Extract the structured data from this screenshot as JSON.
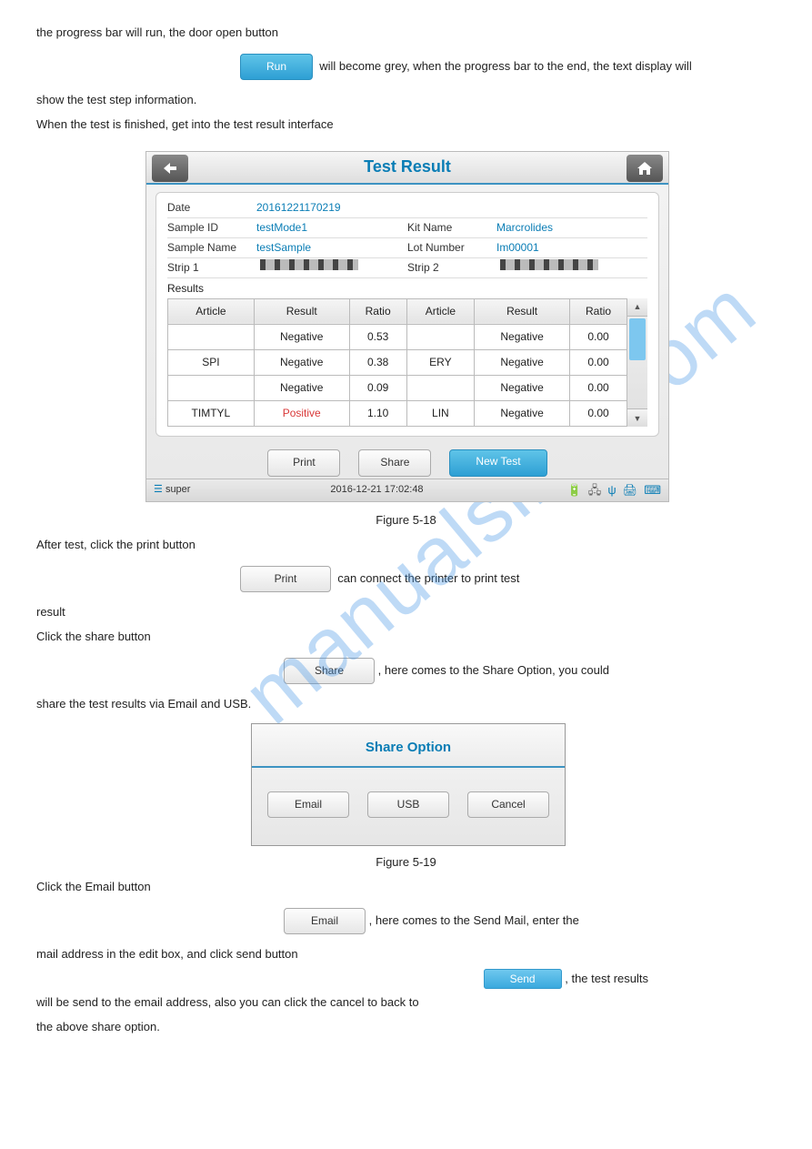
{
  "para": {
    "intro1": "the progress bar will run, the door open button",
    "intro2": "will become grey, when the progress bar to the end, the text display will",
    "intro3": "show the test step information.",
    "p2": "When the test is finished, get into the test result interface",
    "figRun": "Figure 5-18",
    "afterFig1": "After test, click the print button",
    "afterFig1b": "can connect the printer to print test",
    "afterFig2": "result",
    "shareLine": "Click the share button",
    "shareLine2": ", here comes to the Share Option, you could",
    "shareLine3": "share the test results via Email and USB.",
    "figShare": "Figure 5-19",
    "emailLine": "Click the Email button",
    "emailLine2": ", here comes to the Send Mail, enter the",
    "emailLine3": "mail address in the edit box, and click send button",
    "emailLine4": ", the test results",
    "emailLine5": "will be send to the email address, also you can click the cancel to back to",
    "emailLine6": "the above share option."
  },
  "buttons": {
    "run": "Run",
    "print": "Print",
    "share": "Share",
    "newTest": "New Test",
    "email": "Email",
    "usb": "USB",
    "cancel": "Cancel",
    "send": "Send",
    "printInline": "Print",
    "shareInline": "Share",
    "emailInline": "Email"
  },
  "window": {
    "title": "Test Result",
    "meta": {
      "dateLabel": "Date",
      "dateVal": "20161221170219",
      "sampleIdLabel": "Sample ID",
      "sampleIdVal": "testMode1",
      "kitLabel": "Kit Name",
      "kitVal": "Marcrolides",
      "sampleNameLabel": "Sample Name",
      "sampleNameVal": "testSample",
      "lotLabel": "Lot Number",
      "lotVal": "Im00001",
      "strip1": "Strip 1",
      "strip2": "Strip 2",
      "resultsLabel": "Results"
    },
    "headers": {
      "article": "Article",
      "result": "Result",
      "ratio": "Ratio"
    },
    "rows": [
      {
        "a1": "",
        "r1": "Negative",
        "t1": "0.53",
        "a2": "",
        "r2": "Negative",
        "t2": "0.00"
      },
      {
        "a1": "SPI",
        "r1": "Negative",
        "t1": "0.38",
        "a2": "ERY",
        "r2": "Negative",
        "t2": "0.00"
      },
      {
        "a1": "",
        "r1": "Negative",
        "t1": "0.09",
        "a2": "",
        "r2": "Negative",
        "t2": "0.00"
      },
      {
        "a1": "TIMTYL",
        "r1": "Positive",
        "t1": "1.10",
        "a2": "LIN",
        "r2": "Negative",
        "t2": "0.00"
      }
    ],
    "statusUser": "super",
    "statusTime": "2016-12-21 17:02:48"
  },
  "dialog": {
    "title": "Share Option"
  }
}
